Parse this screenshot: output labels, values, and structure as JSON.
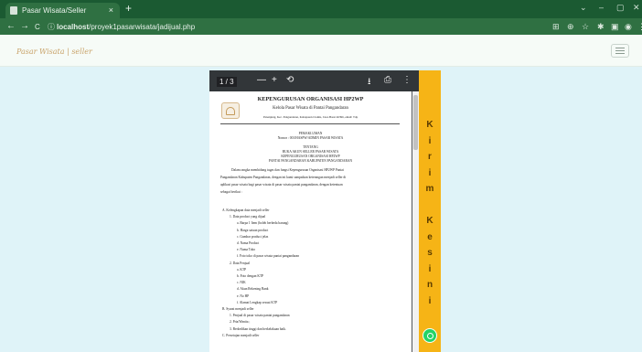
{
  "browser": {
    "tab_title": "Pasar Wisata/Seller",
    "tab_close": "×",
    "new_tab": "+",
    "url_host": "localhost",
    "url_path": "/proyek1pasarwisata/jadijual.php",
    "back": "←",
    "forward": "→",
    "reload": "C",
    "info": "ⓘ",
    "min": "⌄",
    "minimize": "–",
    "maximize": "▢",
    "close": "✕"
  },
  "header": {
    "brand": "Pasar Wisata | seller"
  },
  "pdf": {
    "page_counter": "1 / 3",
    "zoom_out": "—",
    "zoom_in": "+",
    "rotate": "⟲",
    "download": "⭳",
    "print": "⎙",
    "more": "⋮",
    "doc_title": "KEPENGURUSAN ORGANISASI HP2WP",
    "doc_subtitle": "Kelola Pasar Wisata di Pantai Pangandaran",
    "address": "Pananjung, Kec. Pangandaran, Kabupaten Ciamis, Jawa Barat 46396, email: Tdp",
    "memo_title": "PEMAKLUMAN",
    "memo_number": "Nomor : 001/HASPW/ADMIN PASAR WISATA",
    "about_label": "TENTANG",
    "about_1": "BUKA AKUN SELLER PASAR WISATA",
    "about_2": "KEPENGURUSAN ORGANISASI HP2WP",
    "about_3": "PANTAI PANGANDARAN KABUPATEN PANGANDARAN",
    "intro_1": "Dalam rangka membidang tugas dan fungsi Kepengurusan Organisasi HP2WP Pantai",
    "intro_2": "Pangandaran Kabupaten Pangandaran, dengan ini kami sampaikan keterangan menjadi seller di",
    "intro_3": "aplikasi pasar wisata bagi pasar wisata di pasar wisata pantai pangandaran, dengan ketentuan",
    "intro_4": "sebagai berikut :",
    "list": [
      {
        "text": "A.  Kelengkapan data menjadi seller",
        "indent": 0
      },
      {
        "text": "1.   Data product yang dijual",
        "indent": 1
      },
      {
        "text": "a.   Barpa 1 Item (boleh berbeda barang)",
        "indent": 2
      },
      {
        "text": "b.   Harga satuan product",
        "indent": 2
      },
      {
        "text": "c.   Gambar product jelas",
        "indent": 2
      },
      {
        "text": "d.   Nama Product",
        "indent": 2
      },
      {
        "text": "e.   Nama Toko",
        "indent": 2
      },
      {
        "text": "f.    Foto toko di pasar wisata pantai pangandaran",
        "indent": 2
      },
      {
        "text": "2.   Data Penjual",
        "indent": 1
      },
      {
        "text": "a.   KTP",
        "indent": 2
      },
      {
        "text": "b.   Foto dengan KTP",
        "indent": 2
      },
      {
        "text": "c.   NIK",
        "indent": 2
      },
      {
        "text": "d.   Akun Rekening Bank",
        "indent": 2
      },
      {
        "text": "e.   No HP",
        "indent": 2
      },
      {
        "text": "f.    Alamat Lengkap sesuai KTP",
        "indent": 2
      },
      {
        "text": "B.  Syarat menjadi seller",
        "indent": 0
      },
      {
        "text": "1.   Penjual di pasar wisata pantai pangandaran",
        "indent": 1
      },
      {
        "text": "2.   Pria/Wanita ;",
        "indent": 1
      },
      {
        "text": "3.   Berkedikan tinggi dan berkelakuan baik.",
        "indent": 1
      },
      {
        "text": "C.  Persetujan menjadi seller",
        "indent": 0
      }
    ]
  },
  "banner": {
    "letters": [
      "K",
      "i",
      "r",
      "i",
      "m",
      "",
      "K",
      "e",
      "s",
      "i",
      "n",
      "i"
    ]
  },
  "colors": {
    "chrome": "#1b5a32",
    "banner": "#f6b416",
    "page_bg": "#dff3f8"
  }
}
